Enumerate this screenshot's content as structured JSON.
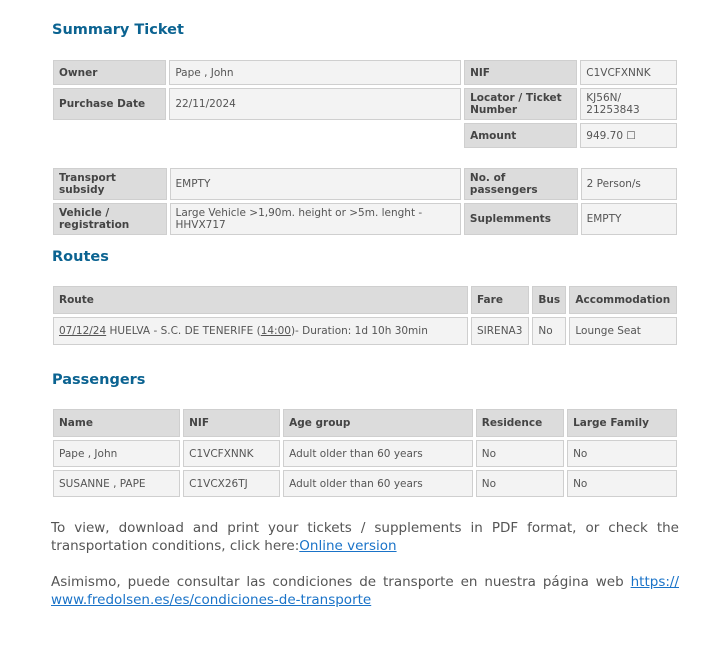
{
  "summary": {
    "heading": "Summary Ticket",
    "owner_label": "Owner",
    "owner_value": "Pape , John",
    "nif_label": "NIF",
    "nif_value": "C1VCFXNNK",
    "purchase_date_label": "Purchase Date",
    "purchase_date_value": "22/11/2024",
    "locator_label": "Locator / Ticket Number",
    "locator_value": "KJ56N/ 21253843",
    "amount_label": "Amount",
    "amount_value": "949.70 ☐"
  },
  "details": {
    "transport_subsidy_label": "Transport subsidy",
    "transport_subsidy_value": "EMPTY",
    "passengers_count_label": "No. of passengers",
    "passengers_count_value": "2 Person/s",
    "vehicle_label": "Vehicle / registration",
    "vehicle_value": "Large Vehicle >1,90m. height or >5m. lenght - HHVX717",
    "supplements_label": "Suplemments",
    "supplements_value": "EMPTY"
  },
  "routes": {
    "heading": "Routes",
    "headers": [
      "Route",
      "Fare",
      "Bus",
      "Accommodation"
    ],
    "row": {
      "date": "07/12/24",
      "route_mid": " HUELVA - S.C. DE TENERIFE (",
      "time": "14:00",
      "route_end": ")- Duration: 1d 10h 30min",
      "fare": "SIRENA3",
      "bus": "No",
      "accommodation": "Lounge Seat"
    }
  },
  "passengers": {
    "heading": "Passengers",
    "headers": [
      "Name",
      "NIF",
      "Age group",
      "Residence",
      "Large Family"
    ],
    "rows": [
      {
        "name": "Pape , John",
        "nif": "C1VCFXNNK",
        "age_group": "Adult older than 60 years",
        "residence": "No",
        "large_family": "No"
      },
      {
        "name": "SUSANNE , PAPE",
        "nif": "C1VCX26TJ",
        "age_group": "Adult older than 60 years",
        "residence": "No",
        "large_family": "No"
      }
    ]
  },
  "footer": {
    "text1": "To view, download and print your tickets / supplements in PDF format, or check the transportation conditions, click here:",
    "link1": "Online version",
    "text2": "Asimismo, puede consultar las condiciones de transporte en nuestra página web ",
    "link2": "https:// www.fredolsen.es/es/condiciones-de-transporte"
  }
}
